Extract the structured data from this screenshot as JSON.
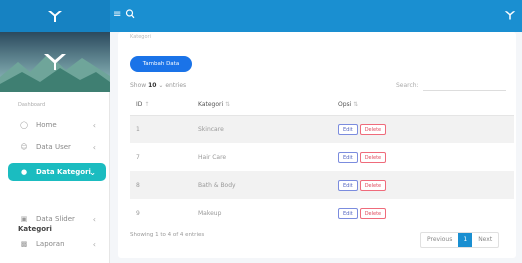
{
  "sidebar": {
    "heading": "Dashboard",
    "items": [
      {
        "label": "Home",
        "icon": "home-icon"
      },
      {
        "label": "Data User",
        "icon": "users-icon"
      },
      {
        "label": "Data Kategori",
        "icon": "tag-icon",
        "active": true
      },
      {
        "label": "Data Slider",
        "icon": "image-icon"
      },
      {
        "label": "Laporan",
        "icon": "report-icon"
      }
    ],
    "sub_item": "Kategori"
  },
  "content": {
    "card_title": "Kategori",
    "add_button": "Tambah Data",
    "show_prefix": "Show",
    "show_value": "10",
    "show_suffix": "entries",
    "search_label": "Search:",
    "columns": [
      "ID",
      "Kategori",
      "Opsi"
    ],
    "rows": [
      {
        "id": "1",
        "kategori": "Skincare"
      },
      {
        "id": "7",
        "kategori": "Hair Care"
      },
      {
        "id": "8",
        "kategori": "Bath & Body"
      },
      {
        "id": "9",
        "kategori": "Makeup"
      }
    ],
    "edit_label": "Edit",
    "delete_label": "Delete",
    "info": "Showing 1 to 4 of 4 entries",
    "pagination": {
      "previous": "Previous",
      "current": "1",
      "next": "Next"
    }
  },
  "colors": {
    "topbar": "#1a8fd1",
    "active": "#1bbcc0",
    "add_button": "#1a73e8"
  }
}
